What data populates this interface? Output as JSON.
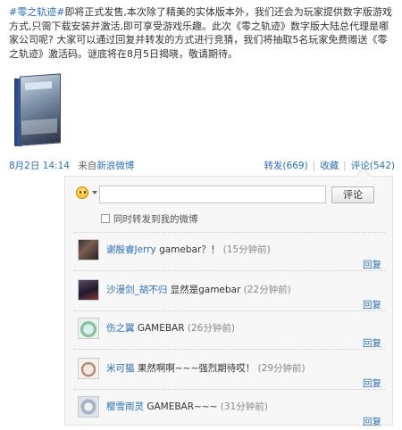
{
  "post": {
    "hashtag": "#零之轨迹#",
    "body": "即将正式发售,本次除了精美的实体版本外，我们还会为玩家提供数字版游戏方式,只需下载安装并激活,即可享受游戏乐趣。此次《零之轨迹》数字版大陆总代理是哪家公司呢? 大家可以通过回复并转发的方式进行竞猜，我们将抽取5名玩家免费赠送《零之轨迹》激活码。谜底将在8月5日揭晓，敬请期待。"
  },
  "meta": {
    "time": "8月2日 14:14",
    "source_prefix": "来自",
    "source": "新浪微博",
    "repost": "转发(669)",
    "separator": "|",
    "favorite": "收藏",
    "comment": "评论(542)"
  },
  "comment_box": {
    "input_value": "",
    "submit": "评论",
    "repost_option": "同时转发到我的微博"
  },
  "comments": [
    {
      "name": "谢殷睿Jerry",
      "text": "gamebar？！",
      "time": "(15分钟前)",
      "reply": "回复"
    },
    {
      "name": "沙漫剑_胡不归",
      "text": "显然是gamebar",
      "time": "(22分钟前)",
      "reply": "回复"
    },
    {
      "name": "伤之翼",
      "text": "GAMEBAR",
      "time": "(26分钟前)",
      "reply": "回复"
    },
    {
      "name": "米可猫",
      "text": "果然啊啊~~~强烈期待哎！",
      "time": "(29分钟前)",
      "reply": "回复"
    },
    {
      "name": "樱雪雨灵",
      "text": "GAMEBAR~~~",
      "time": "(31分钟前)",
      "reply": "回复"
    }
  ]
}
